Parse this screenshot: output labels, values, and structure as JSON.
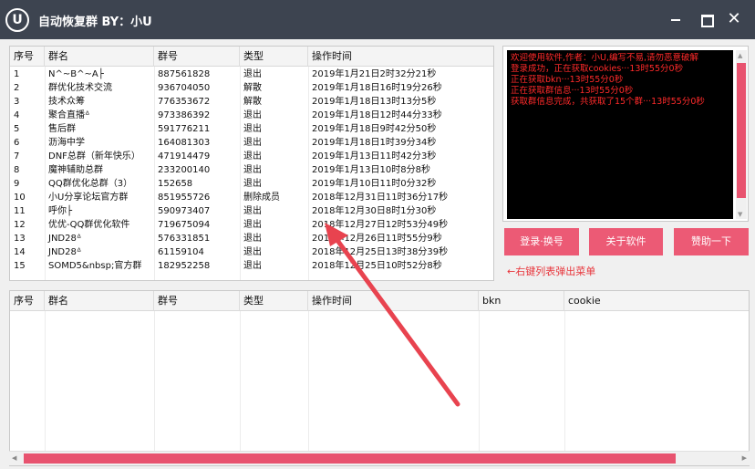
{
  "window": {
    "title": "自动恢复群 BY：小U",
    "logo": "U"
  },
  "top_table": {
    "headers": [
      "序号",
      "群名",
      "群号",
      "类型",
      "操作时间"
    ],
    "rows": [
      [
        "1",
        "N^~B^~A├",
        "887561828",
        "退出",
        "2019年1月21日2时32分21秒"
      ],
      [
        "2",
        "群优化技术交流",
        "936704050",
        "解散",
        "2019年1月18日16时19分26秒"
      ],
      [
        "3",
        "技术众筹",
        "776353672",
        "解散",
        "2019年1月18日13时13分5秒"
      ],
      [
        "4",
        "聚合直播ᐞ",
        "973386392",
        "退出",
        "2019年1月18日12时44分33秒"
      ],
      [
        "5",
        "售后群",
        "591776211",
        "退出",
        "2019年1月18日9时42分50秒"
      ],
      [
        "6",
        "沥海中学",
        "164081303",
        "退出",
        "2019年1月18日1时39分34秒"
      ],
      [
        "7",
        "DNF总群（新年快乐）",
        "471914479",
        "退出",
        "2019年1月13日11时42分3秒"
      ],
      [
        "8",
        "魔神辅助总群",
        "233200140",
        "退出",
        "2019年1月13日10时8分8秒"
      ],
      [
        "9",
        "QQ群优化总群（3）",
        "152658",
        "退出",
        "2019年1月10日11时0分32秒"
      ],
      [
        "10",
        "小U分享论坛官方群",
        "851955726",
        "删除成员",
        "2018年12月31日11时36分17秒"
      ],
      [
        "11",
        "呼你├",
        "590973407",
        "退出",
        "2018年12月30日8时1分30秒"
      ],
      [
        "12",
        "优优-QQ群优化软件",
        "719675094",
        "退出",
        "2018年12月27日12时53分49秒"
      ],
      [
        "13",
        "JND28ᐞ",
        "576331851",
        "退出",
        "2018年12月26日11时55分9秒"
      ],
      [
        "14",
        "JND28ᐞ",
        "61159104",
        "退出",
        "2018年12月25日13时38分39秒"
      ],
      [
        "15",
        "SOMD5&nbsp;官方群",
        "182952258",
        "退出",
        "2018年12月25日10时52分8秒"
      ]
    ]
  },
  "bottom_table": {
    "headers": [
      "序号",
      "群名",
      "群号",
      "类型",
      "操作时间",
      "bkn",
      "cookie"
    ]
  },
  "log": {
    "lines": [
      "欢迎使用软件,作者：小U,编写不易,请勿恶意破解",
      "登录成功，正在获取cookies···13时55分0秒",
      "正在获取bkn···13时55分0秒",
      "正在获取群信息···13时55分0秒",
      "获取群信息完成，共获取了15个群···13时55分0秒"
    ],
    "text_color": "#ff2a2a"
  },
  "buttons": {
    "login": "登录·换号",
    "about": "关于软件",
    "sponsor": "赞助一下"
  },
  "hint": "←右键列表弹出菜单",
  "colors": {
    "accent": "#ec5a75",
    "titlebar": "#3d4450",
    "hint": "#e8353b"
  }
}
